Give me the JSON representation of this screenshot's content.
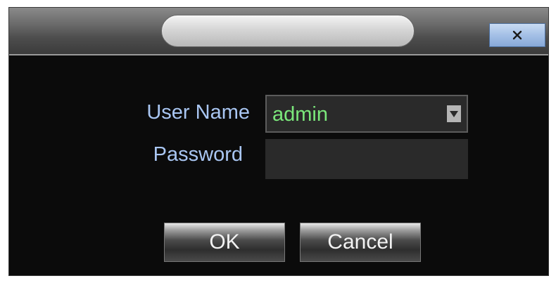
{
  "dialog": {
    "title": "",
    "close_label": "x",
    "username_label": "User Name",
    "username_value": "admin",
    "password_label": "Password",
    "password_value": "",
    "ok_label": "OK",
    "cancel_label": "Cancel"
  },
  "icons": {
    "close": "close-icon",
    "dropdown": "chevron-down-icon"
  },
  "colors": {
    "label_text": "#a9c6f2",
    "selected_value_text": "#7be87b",
    "dialog_background": "#0b0b0b"
  }
}
